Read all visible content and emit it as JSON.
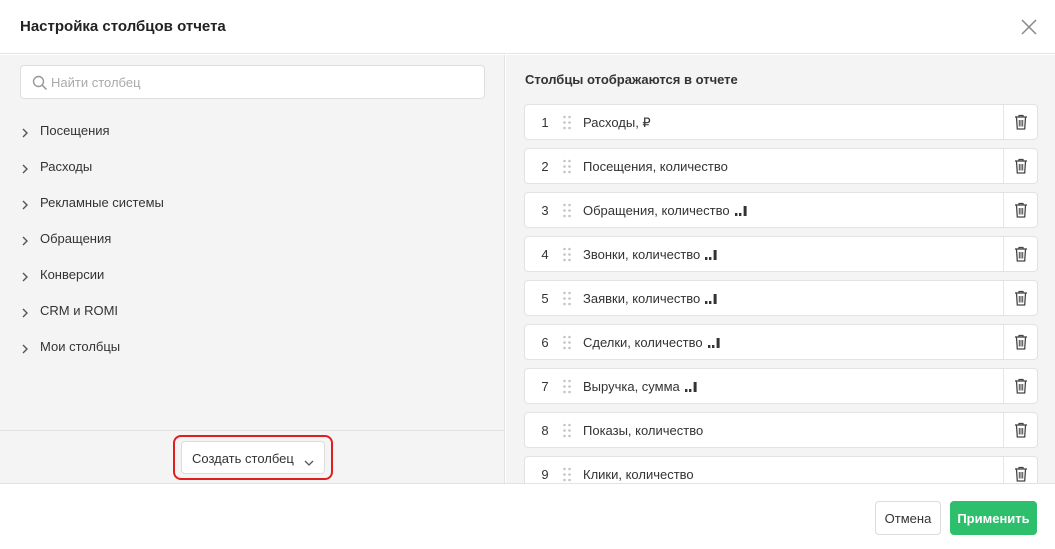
{
  "dialog": {
    "title": "Настройка столбцов отчета"
  },
  "search": {
    "placeholder": "Найти столбец"
  },
  "categories": [
    {
      "label": "Посещения"
    },
    {
      "label": "Расходы"
    },
    {
      "label": "Рекламные системы"
    },
    {
      "label": "Обращения"
    },
    {
      "label": "Конверсии"
    },
    {
      "label": "CRM и ROMI"
    },
    {
      "label": "Мои столбцы"
    }
  ],
  "create_button": {
    "label": "Создать столбец"
  },
  "selected": {
    "heading": "Столбцы отображаются в отчете",
    "columns": [
      {
        "index": "1",
        "name": "Расходы, ₽",
        "attribution_icon": false
      },
      {
        "index": "2",
        "name": "Посещения, количество",
        "attribution_icon": false
      },
      {
        "index": "3",
        "name": "Обращения, количество",
        "attribution_icon": true
      },
      {
        "index": "4",
        "name": "Звонки, количество",
        "attribution_icon": true
      },
      {
        "index": "5",
        "name": "Заявки, количество",
        "attribution_icon": true
      },
      {
        "index": "6",
        "name": "Сделки, количество",
        "attribution_icon": true
      },
      {
        "index": "7",
        "name": "Выручка, сумма",
        "attribution_icon": true
      },
      {
        "index": "8",
        "name": "Показы, количество",
        "attribution_icon": false
      },
      {
        "index": "9",
        "name": "Клики, количество",
        "attribution_icon": false
      }
    ]
  },
  "footer": {
    "cancel_label": "Отмена",
    "apply_label": "Применить"
  },
  "colors": {
    "accent_green": "#2dbf6b",
    "highlight_red": "#e01e1e",
    "panel_bg": "#f4f4f4"
  },
  "icons": {
    "close": "close-icon",
    "search": "search-icon",
    "category_expand": "chevron-right-icon",
    "dropdown": "chevron-down-icon",
    "drag": "drag-handle-icon",
    "attribution": "bar-chart-icon",
    "delete": "trash-icon"
  }
}
